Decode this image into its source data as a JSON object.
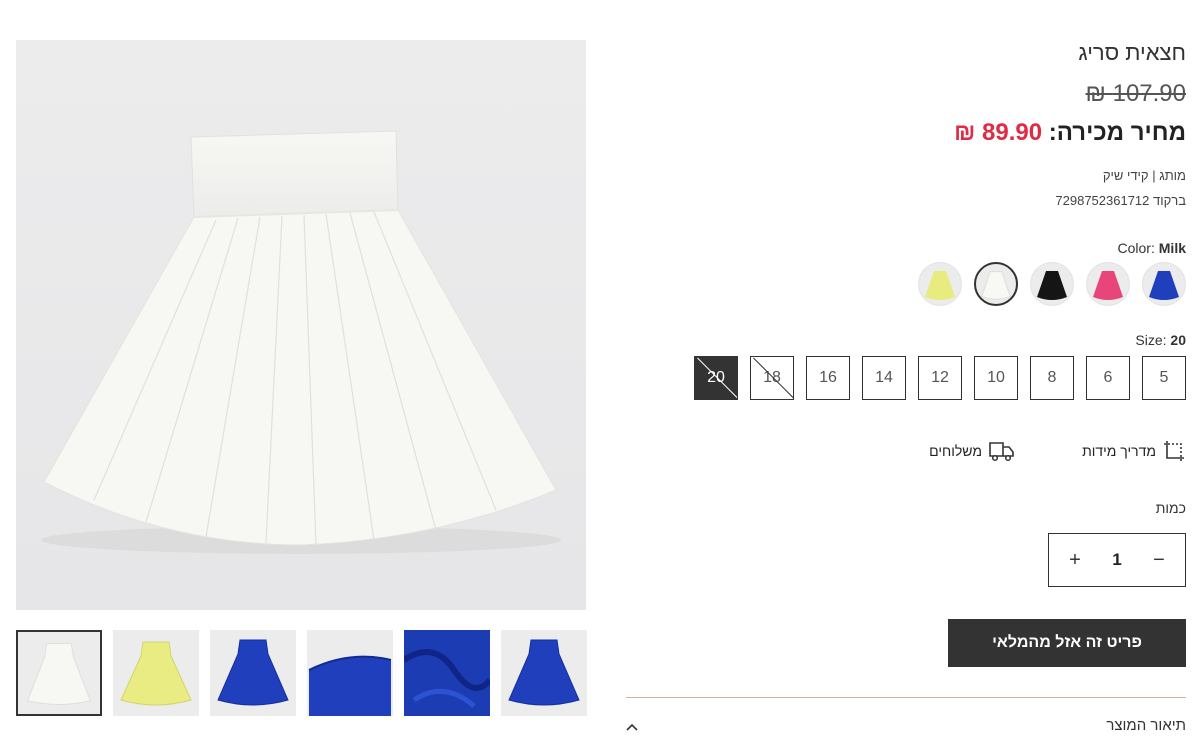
{
  "product": {
    "title": "חצאית סריג",
    "old_price": "107.90 ₪",
    "sale_label": "מחיר מכירה:",
    "sale_price": "89.90 ₪",
    "brand_line": "מותג | קידי שיק",
    "barcode_line": "ברקוד 7298752361712"
  },
  "color": {
    "label": "Color:",
    "selected": "Milk",
    "swatches": [
      {
        "name": "blue",
        "hex": "#1d3fb8"
      },
      {
        "name": "pink",
        "hex": "#e8467b"
      },
      {
        "name": "black",
        "hex": "#151515"
      },
      {
        "name": "milk",
        "hex": "#f6f6f1"
      },
      {
        "name": "yellow",
        "hex": "#e8ec7e"
      }
    ]
  },
  "size": {
    "label": "Size:",
    "selected": "20",
    "options": [
      "5",
      "6",
      "8",
      "10",
      "12",
      "14",
      "16",
      "18",
      "20"
    ]
  },
  "utilities": {
    "size_guide": "מדריך מידות",
    "shipping": "משלוחים"
  },
  "quantity": {
    "label": "כמות",
    "value": "1",
    "minus": "−",
    "plus": "+"
  },
  "actions": {
    "sold_out": "פריט זה אזל מהמלאי"
  },
  "description": {
    "title": "תיאור המוצר"
  },
  "gallery": {
    "thumbnails": [
      "milk-skirt",
      "yellow-skirt",
      "blue-skirt",
      "blue-waistband",
      "blue-fabric-closeup",
      "blue-skirt"
    ]
  }
}
